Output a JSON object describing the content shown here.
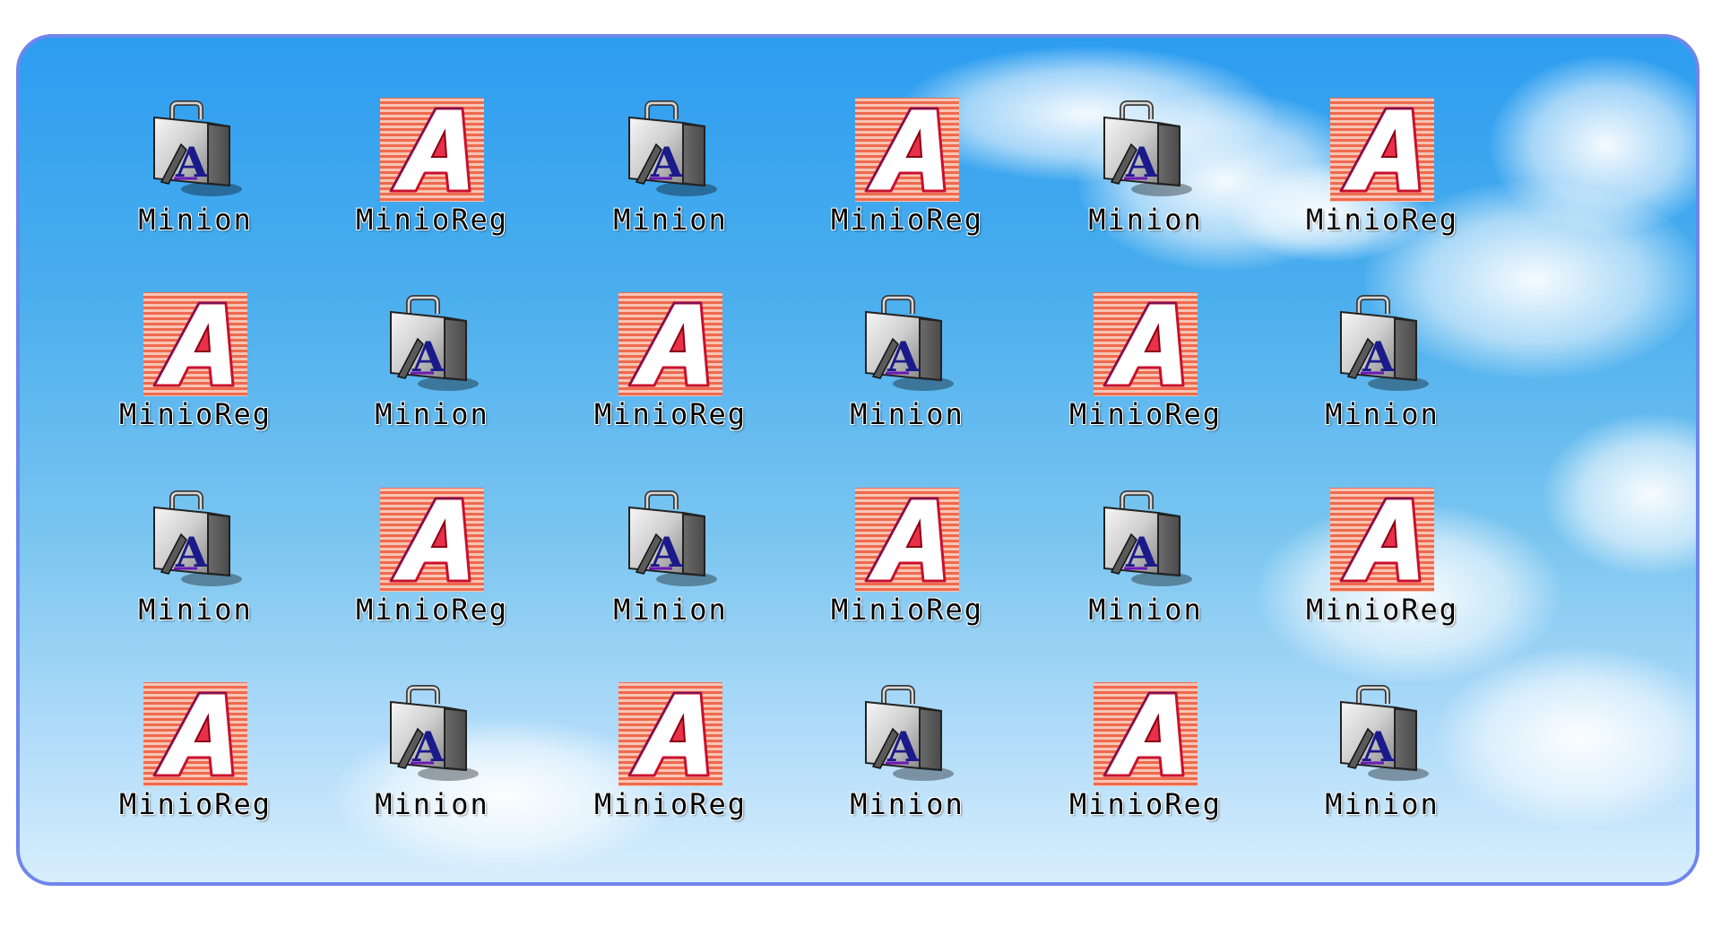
{
  "desktop": {
    "accent_color": "#6f86ea",
    "icons": [
      {
        "label": "Minion",
        "icon": "briefcase-app-icon"
      },
      {
        "label": "MinioReg",
        "icon": "striped-letter-a-icon"
      },
      {
        "label": "Minion",
        "icon": "briefcase-app-icon"
      },
      {
        "label": "MinioReg",
        "icon": "striped-letter-a-icon"
      },
      {
        "label": "Minion",
        "icon": "briefcase-app-icon"
      },
      {
        "label": "MinioReg",
        "icon": "striped-letter-a-icon"
      },
      {
        "label": "MinioReg",
        "icon": "striped-letter-a-icon"
      },
      {
        "label": "Minion",
        "icon": "briefcase-app-icon"
      },
      {
        "label": "MinioReg",
        "icon": "striped-letter-a-icon"
      },
      {
        "label": "Minion",
        "icon": "briefcase-app-icon"
      },
      {
        "label": "MinioReg",
        "icon": "striped-letter-a-icon"
      },
      {
        "label": "Minion",
        "icon": "briefcase-app-icon"
      },
      {
        "label": "Minion",
        "icon": "briefcase-app-icon"
      },
      {
        "label": "MinioReg",
        "icon": "striped-letter-a-icon"
      },
      {
        "label": "Minion",
        "icon": "briefcase-app-icon"
      },
      {
        "label": "MinioReg",
        "icon": "striped-letter-a-icon"
      },
      {
        "label": "Minion",
        "icon": "briefcase-app-icon"
      },
      {
        "label": "MinioReg",
        "icon": "striped-letter-a-icon"
      },
      {
        "label": "MinioReg",
        "icon": "striped-letter-a-icon"
      },
      {
        "label": "Minion",
        "icon": "briefcase-app-icon"
      },
      {
        "label": "MinioReg",
        "icon": "striped-letter-a-icon"
      },
      {
        "label": "Minion",
        "icon": "briefcase-app-icon"
      },
      {
        "label": "MinioReg",
        "icon": "striped-letter-a-icon"
      },
      {
        "label": "Minion",
        "icon": "briefcase-app-icon"
      }
    ]
  }
}
